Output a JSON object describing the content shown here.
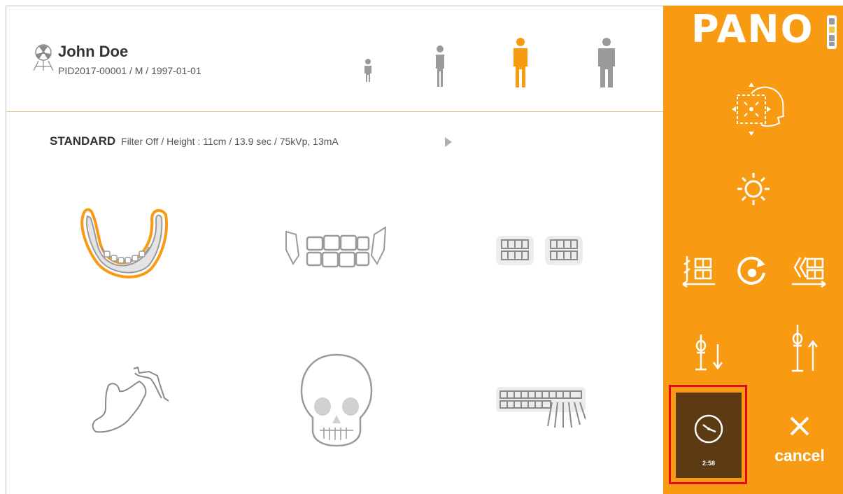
{
  "patient": {
    "name": "John Doe",
    "info": "PID2017-00001 / M / 1997-01-01"
  },
  "body_sizes": [
    {
      "name": "child-small",
      "selected": false
    },
    {
      "name": "child",
      "selected": false
    },
    {
      "name": "adult",
      "selected": true
    },
    {
      "name": "adult-large",
      "selected": false
    }
  ],
  "protocol": {
    "mode": "STANDARD",
    "details": "Filter Off / Height : 11cm / 13.9 sec / 75kVp, 13mA"
  },
  "scan_types": [
    {
      "icon": "standard-arch-icon",
      "selected": true
    },
    {
      "icon": "tmj-icon",
      "selected": false
    },
    {
      "icon": "bitewing-icon",
      "selected": false
    },
    {
      "icon": "half-jaw-icon",
      "selected": false
    },
    {
      "icon": "skull-icon",
      "selected": false
    },
    {
      "icon": "full-dentition-icon",
      "selected": false
    }
  ],
  "side_panel": {
    "title": "PANO",
    "timer_value": "2:58",
    "cancel_label": "cancel"
  },
  "colors": {
    "accent": "#f99b12",
    "timer_bg": "#5c3a13",
    "highlight": "#e4091c",
    "inactive": "#8a8a8a"
  }
}
